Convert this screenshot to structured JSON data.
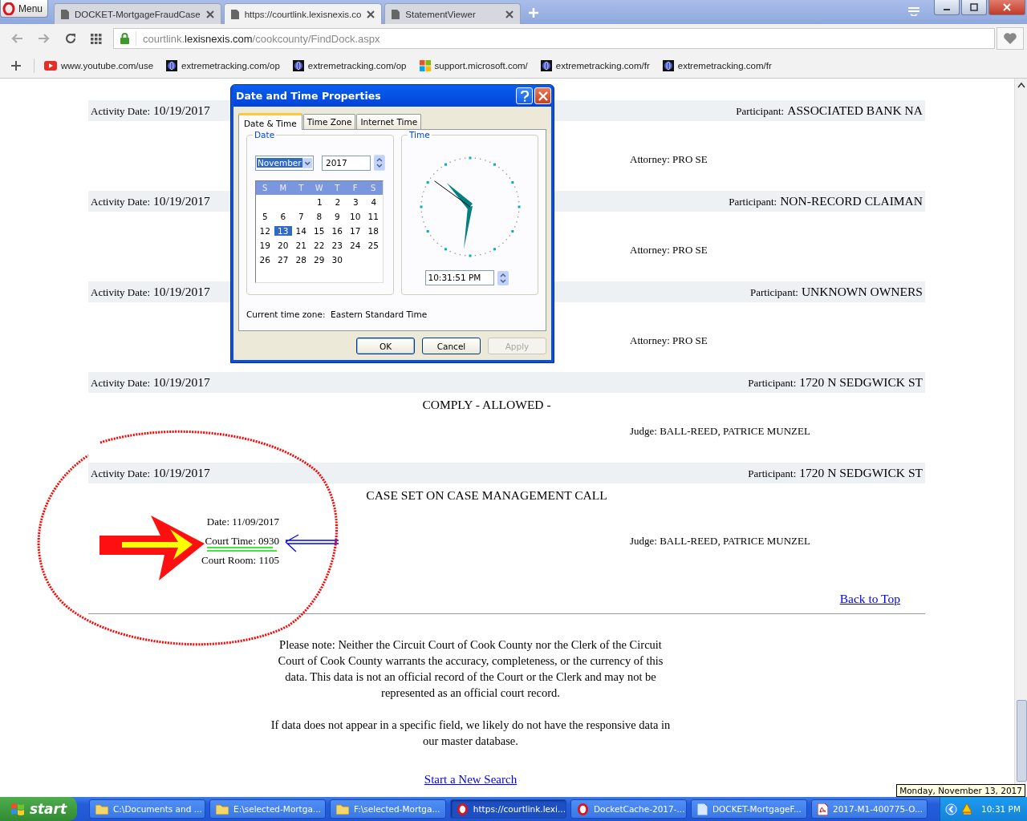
{
  "browser": {
    "menu_label": "Menu",
    "tabs": [
      {
        "title": "DOCKET-MortgageFraudCase",
        "selected": false
      },
      {
        "title": "https://courtlink.lexisnexis.co",
        "selected": true
      },
      {
        "title": "StatementViewer",
        "selected": false
      }
    ],
    "address": {
      "host_prefix": "courtlink.",
      "host": "lexisnexis.com",
      "path": "/cookcounty/FindDock.aspx"
    },
    "bookmarks": [
      {
        "label": "www.youtube.com/use",
        "kind": "video"
      },
      {
        "label": "extremetracking.com/op",
        "kind": "globe"
      },
      {
        "label": "extremetracking.com/op",
        "kind": "globe"
      },
      {
        "label": "support.microsoft.com/",
        "kind": "windows"
      },
      {
        "label": "extremetracking.com/fr",
        "kind": "globe"
      },
      {
        "label": "extremetracking.com/fr",
        "kind": "globe"
      }
    ]
  },
  "page": {
    "entries": [
      {
        "activity": {
          "label": "Activity Date:",
          "value": "10/19/2017"
        },
        "participant": {
          "label": "Participant:",
          "value": "ASSOCIATED BANK NA"
        },
        "party": {
          "label": "Attorney:",
          "value": "PRO SE"
        }
      },
      {
        "activity": {
          "label": "Activity Date:",
          "value": "10/19/2017"
        },
        "participant": {
          "label": "Participant:",
          "value": "NON-RECORD CLAIMAN"
        },
        "party": {
          "label": "Attorney:",
          "value": "PRO SE"
        }
      },
      {
        "activity": {
          "label": "Activity Date:",
          "value": "10/19/2017"
        },
        "participant": {
          "label": "Participant:",
          "value": "UNKNOWN OWNERS"
        },
        "party": {
          "label": "Attorney:",
          "value": "PRO SE"
        }
      },
      {
        "activity": {
          "label": "Activity Date:",
          "value": "10/19/2017"
        },
        "participant": {
          "label": "Participant:",
          "value": "1720 N SEDGWICK ST"
        },
        "description": "COMPLY - ALLOWED -",
        "party": {
          "label": "Judge:",
          "value": "BALL-REED, PATRICE MUNZEL"
        }
      },
      {
        "activity": {
          "label": "Activity Date:",
          "value": "10/19/2017"
        },
        "participant": {
          "label": "Participant:",
          "value": "1720 N SEDGWICK ST"
        },
        "description": "CASE SET ON CASE MANAGEMENT CALL",
        "hearing": [
          {
            "label": "Date:",
            "value": "11/09/2017"
          },
          {
            "label": "Court Time:",
            "value": "0930"
          },
          {
            "label": "Court Room:",
            "value": "1105"
          }
        ],
        "party": {
          "label": "Judge:",
          "value": "BALL-REED, PATRICE MUNZEL"
        }
      }
    ],
    "back_to_top": "Back to Top",
    "notice": [
      "Please note: Neither the Circuit Court of Cook County nor the Clerk of the Circuit Court of Cook County warrants the accuracy, completeness, or the currency of this data. This data is not an official record of the Court or the Clerk and may not be represented as an official court record.",
      "If data does not appear in a specific field, we likely do not have the responsive data in our master database."
    ],
    "new_search": "Start a New Search"
  },
  "dialog": {
    "title": "Date and Time Properties",
    "tabs": [
      {
        "label": "Date & Time",
        "selected": true
      },
      {
        "label": "Time Zone",
        "selected": false
      },
      {
        "label": "Internet Time",
        "selected": false
      }
    ],
    "date_group": {
      "label": "Date",
      "month": "November",
      "year": "2017",
      "weekdays": [
        "S",
        "M",
        "T",
        "W",
        "T",
        "F",
        "S"
      ],
      "weeks": [
        {
          "kind": "leading_gap",
          "days": [
            {
              "label": "1",
              "selected": false
            },
            {
              "label": "2",
              "selected": false
            },
            {
              "label": "3",
              "selected": false
            },
            {
              "label": "4",
              "selected": false
            }
          ]
        },
        {
          "kind": "full",
          "days": [
            {
              "label": "5",
              "selected": false
            },
            {
              "label": "6",
              "selected": false
            },
            {
              "label": "7",
              "selected": false
            },
            {
              "label": "8",
              "selected": false
            },
            {
              "label": "9",
              "selected": false
            },
            {
              "label": "10",
              "selected": false
            },
            {
              "label": "11",
              "selected": false
            }
          ]
        },
        {
          "kind": "full",
          "days": [
            {
              "label": "12",
              "selected": false
            },
            {
              "label": "13",
              "selected": true
            },
            {
              "label": "14",
              "selected": false
            },
            {
              "label": "15",
              "selected": false
            },
            {
              "label": "16",
              "selected": false
            },
            {
              "label": "17",
              "selected": false
            },
            {
              "label": "18",
              "selected": false
            }
          ]
        },
        {
          "kind": "full",
          "days": [
            {
              "label": "19",
              "selected": false
            },
            {
              "label": "20",
              "selected": false
            },
            {
              "label": "21",
              "selected": false
            },
            {
              "label": "22",
              "selected": false
            },
            {
              "label": "23",
              "selected": false
            },
            {
              "label": "24",
              "selected": false
            },
            {
              "label": "25",
              "selected": false
            }
          ]
        },
        {
          "kind": "trailing_gap",
          "days": [
            {
              "label": "26",
              "selected": false
            },
            {
              "label": "27",
              "selected": false
            },
            {
              "label": "28",
              "selected": false
            },
            {
              "label": "29",
              "selected": false
            },
            {
              "label": "30",
              "selected": false
            }
          ]
        }
      ]
    },
    "time_group": {
      "label": "Time",
      "time": "10:31:51 PM"
    },
    "timezone": {
      "label": "Current time zone:",
      "value": "Eastern Standard Time"
    },
    "buttons": [
      {
        "label": "OK",
        "disabled": false
      },
      {
        "label": "Cancel",
        "disabled": false
      },
      {
        "label": "Apply",
        "disabled": true
      }
    ]
  },
  "taskbar": {
    "start": "start",
    "items": [
      {
        "label": "C:\\Documents and ...",
        "kind": "folder",
        "selected": false
      },
      {
        "label": "E:\\selected-Mortga...",
        "kind": "folder",
        "selected": false
      },
      {
        "label": "F:\\selected-Mortga...",
        "kind": "folder",
        "selected": false
      },
      {
        "label": "https://courtlink.lexi...",
        "kind": "opera",
        "selected": true
      },
      {
        "label": "DocketCache-2017-...",
        "kind": "opera",
        "selected": false
      },
      {
        "label": "DOCKET-MortgageF...",
        "kind": "document",
        "selected": false
      },
      {
        "label": "2017-M1-400775-O...",
        "kind": "pdf",
        "selected": false
      }
    ],
    "clock": "10:31 PM",
    "tooltip": "Monday, November 13, 2017"
  }
}
